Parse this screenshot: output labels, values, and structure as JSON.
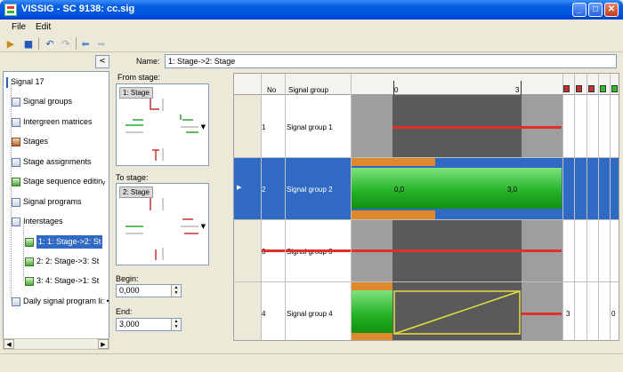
{
  "window": {
    "title": "VISSIG - SC 9138: cc.sig"
  },
  "menu": {
    "file": "File",
    "edit": "Edit"
  },
  "toolbar": {
    "icons": [
      "open-icon",
      "save-icon",
      "undo-icon",
      "redo-icon",
      "back-icon",
      "forward-icon"
    ]
  },
  "tree": {
    "root": "Signal 17",
    "items": [
      {
        "label": "Signal groups"
      },
      {
        "label": "Intergreen matrices"
      },
      {
        "label": "Stages"
      },
      {
        "label": "Stage assignments"
      },
      {
        "label": "Stage sequence editinᵧ"
      },
      {
        "label": "Signal programs"
      },
      {
        "label": "Interstages"
      }
    ],
    "interstages": [
      {
        "label": "1: 1: Stage->2: St"
      },
      {
        "label": "2: 2: Stage->3: St"
      },
      {
        "label": "3: 4: Stage->1: St"
      }
    ],
    "daily": "Daily signal program li: •"
  },
  "form": {
    "name_label": "Name:",
    "name_value": "1: Stage->2: Stage",
    "from_label": "From stage:",
    "from_stage": "1: Stage",
    "to_label": "To stage:",
    "to_stage": "2: Stage",
    "begin_label": "Begin:",
    "begin_value": "0,000",
    "end_label": "End:",
    "end_value": "3,000"
  },
  "grid": {
    "col_no": "No",
    "col_group": "Signal group",
    "axis_start": "0",
    "axis_end": "3",
    "rows": [
      {
        "no": "1",
        "name": "Signal group 1",
        "extra_left": "",
        "extra_right": ""
      },
      {
        "no": "2",
        "name": "Signal group 2",
        "bar_start": "0,0",
        "bar_end": "3,0"
      },
      {
        "no": "3",
        "name": "Signal group 3",
        "extra_left": "",
        "extra_right": ""
      },
      {
        "no": "4",
        "name": "Signal group 4",
        "extra_left": "3",
        "extra_right": "0"
      }
    ]
  },
  "colors": {
    "selection": "#316ac5",
    "red_bar": "#e0302a",
    "green": "#2ebd2e",
    "amber": "#e0892c",
    "yellow": "#e6e040"
  }
}
